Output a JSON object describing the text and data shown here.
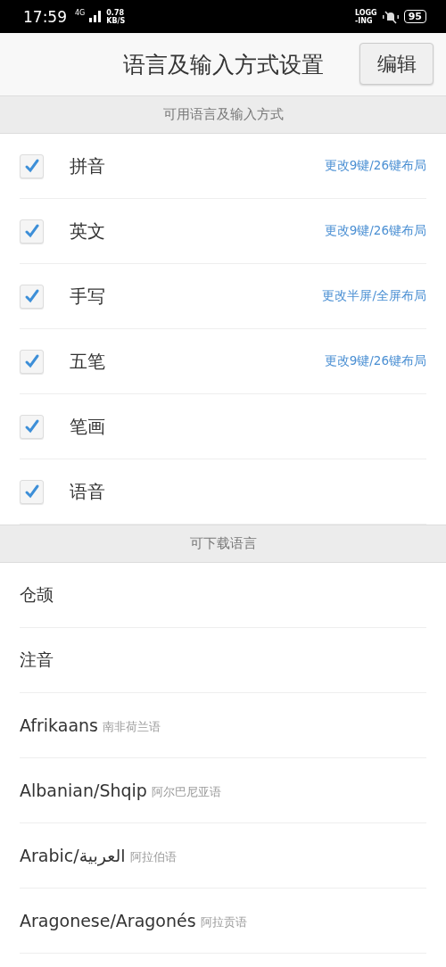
{
  "status_bar": {
    "time": "17:59",
    "network": "4G",
    "speed": [
      "0.78",
      "KB/S"
    ],
    "logging": [
      "LOGG",
      "-ING"
    ],
    "battery": "95"
  },
  "header": {
    "title": "语言及输入方式设置",
    "edit_button": "编辑"
  },
  "available_section": {
    "title": "可用语言及输入方式",
    "items": [
      {
        "label": "拼音",
        "checked": true,
        "action": "更改9键/26键布局"
      },
      {
        "label": "英文",
        "checked": true,
        "action": "更改9键/26键布局"
      },
      {
        "label": "手写",
        "checked": true,
        "action": "更改半屏/全屏布局"
      },
      {
        "label": "五笔",
        "checked": true,
        "action": "更改9键/26键布局"
      },
      {
        "label": "笔画",
        "checked": true
      },
      {
        "label": "语音",
        "checked": true
      }
    ]
  },
  "download_section": {
    "title": "可下载语言",
    "items": [
      {
        "name": "仓颉"
      },
      {
        "name": "注音"
      },
      {
        "name": "Afrikaans",
        "native": "南非荷兰语"
      },
      {
        "name": "Albanian/Shqip",
        "native": "阿尔巴尼亚语"
      },
      {
        "name": "Arabic/العربية",
        "native": "阿拉伯语"
      },
      {
        "name": "Aragonese/Aragonés",
        "native": "阿拉贡语"
      }
    ]
  }
}
